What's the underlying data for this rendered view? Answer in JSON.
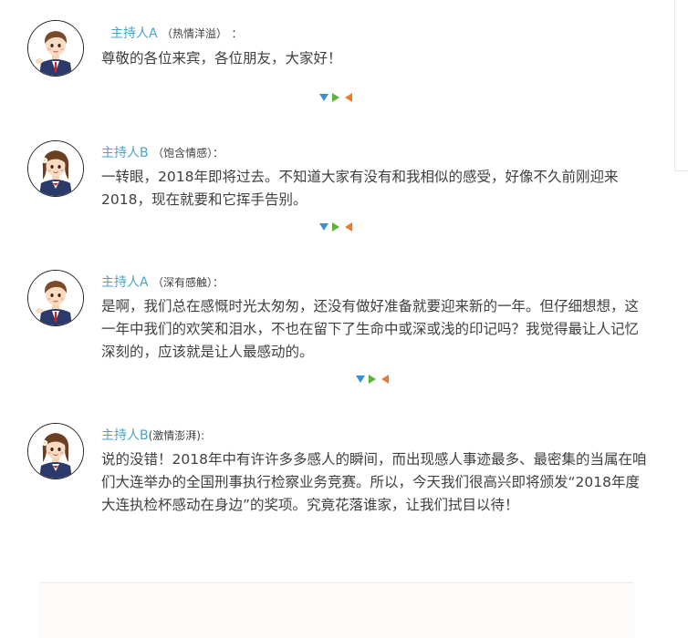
{
  "dialogues": [
    {
      "speaker": "主持人A",
      "mood": "（热情洋溢）",
      "colon": "：",
      "text": "尊敬的各位来宾，各位朋友，大家好！"
    },
    {
      "speaker": "主持人B",
      "mood": "（饱含情感）：",
      "colon": "",
      "text": "一转眼，2018年即将过去。不知道大家有没有和我相似的感受，好像不久前刚迎来2018，现在就要和它挥手告别。"
    },
    {
      "speaker": "主持人A",
      "mood": "（深有感触）：",
      "colon": "",
      "text": "是啊，我们总在感慨时光太匆匆，还没有做好准备就要迎来新的一年。但仔细想想，这一年中我们的欢笑和泪水，不也在留下了生命中或深或浅的印记吗？我觉得最让人记忆深刻的，应该就是让人最感动的。"
    },
    {
      "speaker": "主持人B",
      "mood": "(激情澎湃):",
      "colon": "",
      "text": "说的没错！2018年中有许许多多感人的瞬间，而出现感人事迹最多、最密集的当属在咱们大连举办的全国刑事执行检察业务竞赛。所以，今天我们很高兴即将颁发“2018年度大连执检杯感动在身边”的奖项。究竟花落谁家，让我们拭目以待！"
    }
  ],
  "icons": {
    "avatar_male": "boy-host-avatar-icon",
    "avatar_female": "girl-host-avatar-icon",
    "divider": "triangle-divider-icon"
  },
  "colors": {
    "speaker_name": "#4aa3c8",
    "text": "#3f3f3f",
    "triangle_blue": "#3a8fd0",
    "triangle_green": "#5ab43c",
    "triangle_orange": "#f07a2a"
  }
}
